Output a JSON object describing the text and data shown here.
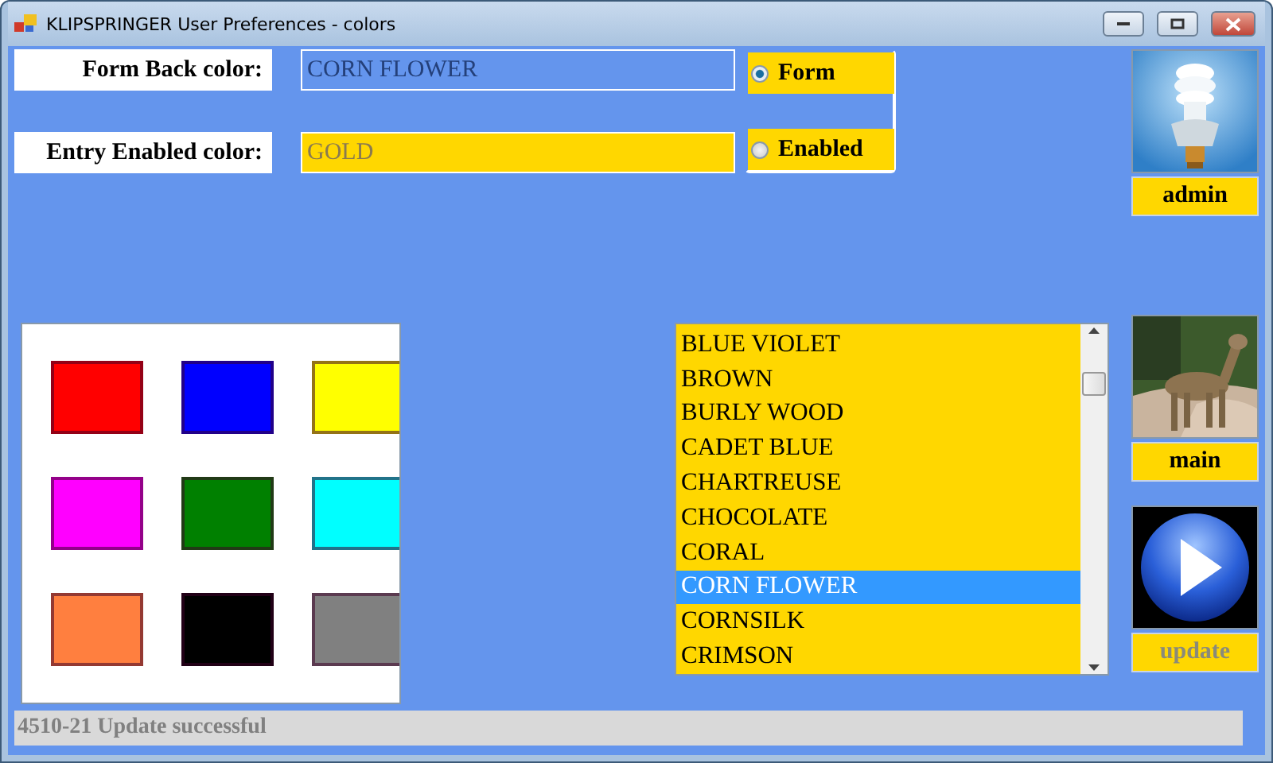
{
  "window": {
    "title": "KLIPSPRINGER User Preferences - colors"
  },
  "fields": [
    {
      "label": "Form Back color:",
      "value": "CORN FLOWER",
      "kind": "form"
    },
    {
      "label": "Entry Enabled color:",
      "value": "GOLD",
      "kind": "entry"
    }
  ],
  "radios": [
    {
      "label": "Form",
      "selected": true
    },
    {
      "label": "Enabled",
      "selected": false
    }
  ],
  "swatches": [
    {
      "color": "#ff0000"
    },
    {
      "color": "#0000ff"
    },
    {
      "color": "#ffff00"
    },
    {
      "color": "#ff00ff"
    },
    {
      "color": "#008000"
    },
    {
      "color": "#00ffff"
    },
    {
      "color": "#ff7f3f"
    },
    {
      "color": "#000000"
    },
    {
      "color": "#808080"
    }
  ],
  "color_list": [
    {
      "label": "BLUE VIOLET",
      "selected": false
    },
    {
      "label": "BROWN",
      "selected": false
    },
    {
      "label": "BURLY WOOD",
      "selected": false
    },
    {
      "label": "CADET BLUE",
      "selected": false
    },
    {
      "label": "CHARTREUSE",
      "selected": false
    },
    {
      "label": "CHOCOLATE",
      "selected": false
    },
    {
      "label": "CORAL",
      "selected": false
    },
    {
      "label": "CORN FLOWER",
      "selected": true
    },
    {
      "label": "CORNSILK",
      "selected": false
    },
    {
      "label": "CRIMSON",
      "selected": false
    }
  ],
  "buttons": [
    {
      "label": "admin",
      "disabled": false
    },
    {
      "label": "main",
      "disabled": false
    },
    {
      "label": "update",
      "disabled": true
    }
  ],
  "status_bar": "4510-21 Update successful"
}
